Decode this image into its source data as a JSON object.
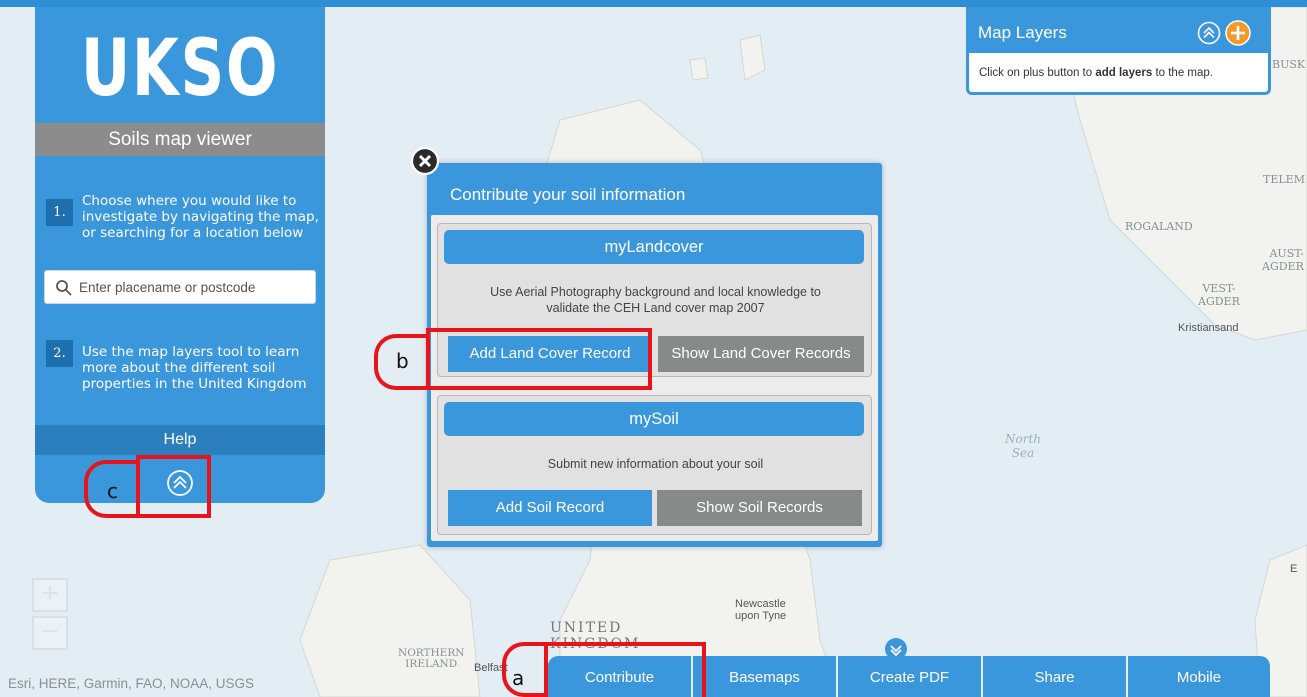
{
  "app": {
    "logo_text": "UKSO",
    "subtitle": "Soils map viewer"
  },
  "steps": [
    {
      "number": "1.",
      "lines": [
        "Choose where you would like to",
        "investigate by navigating the map,",
        "or searching for a location below"
      ]
    },
    {
      "number": "2.",
      "lines": [
        "Use the map layers tool to learn",
        "more about the different soil",
        "properties in the United Kingdom"
      ]
    }
  ],
  "search": {
    "placeholder": "Enter placename or postcode",
    "value": ""
  },
  "help_label": "Help",
  "map_layers": {
    "title": "Map Layers",
    "hint_before": "Click on plus button to ",
    "hint_bold": "add layers",
    "hint_after": " to the map."
  },
  "zoom": {
    "in_label": "+",
    "out_label": "−"
  },
  "attribution": "Esri, HERE, Garmin, FAO, NOAA, USGS",
  "toolbar": {
    "buttons": [
      "Contribute",
      "Basemaps",
      "Create PDF",
      "Share",
      "Mobile"
    ]
  },
  "dialog": {
    "title": "Contribute your soil information",
    "landcover": {
      "header": "myLandcover",
      "desc_lines": [
        "Use Aerial Photography background and local knowledge to",
        "validate the CEH Land cover map 2007"
      ],
      "add_label": "Add Land Cover Record",
      "show_label": "Show Land Cover Records"
    },
    "soil": {
      "header": "mySoil",
      "desc": "Submit new information about your soil",
      "add_label": "Add Soil Record",
      "show_label": "Show Soil Records"
    }
  },
  "map_labels": {
    "north_sea": [
      "North",
      "Sea"
    ],
    "rogaland": "ROGALAND",
    "telemark": "TELEM",
    "aust_agder": [
      "AUST-",
      "AGDER"
    ],
    "vest_agder": [
      "VEST-",
      "AGDER"
    ],
    "kristiansand": "Kristiansand",
    "busk": "BUSK",
    "newcastle": [
      "Newcastle",
      "upon Tyne"
    ],
    "united_kingdom": [
      "UNITED",
      "KINGDOM"
    ],
    "northern_ireland": [
      "NORTHERN",
      "IRELAND"
    ],
    "belfast": "Belfast",
    "edge_e": "E"
  },
  "annotations": [
    "a",
    "b",
    "c"
  ],
  "colors": {
    "accent": "#3b97dc",
    "secondary": "#888a89",
    "annotation": "#e8141b",
    "layers_add": "#f39a2e"
  }
}
